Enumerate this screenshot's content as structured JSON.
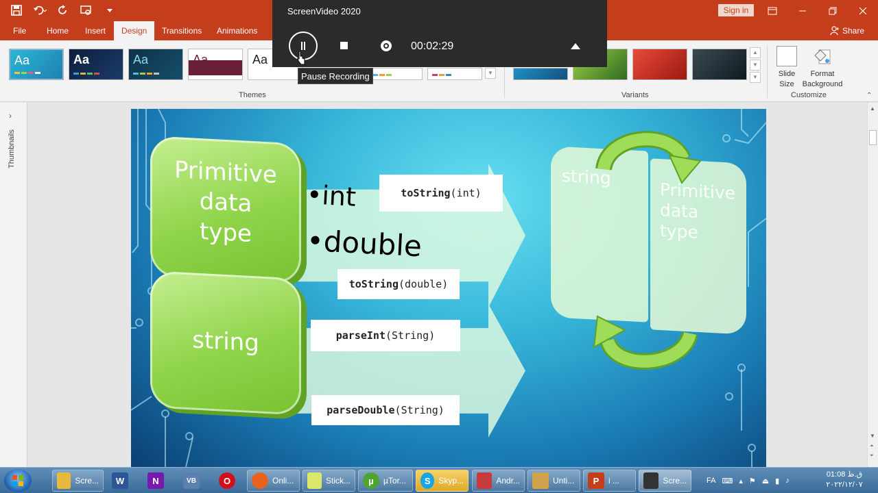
{
  "titlebar": {
    "sign_in": "Sign in",
    "accent": "#c43e1c"
  },
  "tabs": [
    {
      "label": "File"
    },
    {
      "label": "Home"
    },
    {
      "label": "Insert"
    },
    {
      "label": "Design",
      "active": true
    },
    {
      "label": "Transitions"
    },
    {
      "label": "Animations"
    }
  ],
  "share_label": "Share",
  "ribbon": {
    "themes_label": "Themes",
    "variants_label": "Variants",
    "customize_label": "Customize",
    "slide_size_label": "Slide Size",
    "format_background_label_1": "Format",
    "format_background_label_2": "Background",
    "theme_glyph": "Aa"
  },
  "recorder": {
    "title": "ScreenVideo 2020",
    "timer": "00:02:29",
    "tooltip": "Pause Recording"
  },
  "thumbnails_label": "Thumbnails",
  "slide": {
    "box1": [
      "Primitive",
      "data",
      "type"
    ],
    "box2": "string",
    "bullet1": "•int",
    "bullet2": "•double",
    "tostring_int": {
      "method": "toString",
      "arg": "(int)"
    },
    "tostring_double": {
      "method": "toString",
      "arg": "(double)"
    },
    "parseint": {
      "method": "parseInt",
      "arg": "(String)"
    },
    "parsedouble": {
      "method": "parseDouble",
      "arg": "(String)"
    },
    "panel_left": "string",
    "panel_right": [
      "Primitive",
      "data",
      "type"
    ]
  },
  "taskbar": {
    "items": [
      {
        "label": "Scre...",
        "icon": "folder-icon",
        "color": "#e8b93a"
      },
      {
        "label": "",
        "icon": "word-icon",
        "text": "W",
        "color": "#2b5797"
      },
      {
        "label": "",
        "icon": "onenote-icon",
        "text": "N",
        "color": "#7719aa"
      },
      {
        "label": "",
        "icon": "vb-icon",
        "text": "VB",
        "color": "#5c7fb0"
      },
      {
        "label": "",
        "icon": "opera-icon",
        "text": "O",
        "color": "#d1101a"
      },
      {
        "label": "Onli...",
        "icon": "firefox-icon",
        "color": "#e8631e"
      },
      {
        "label": "Stick...",
        "icon": "sticky-notes-icon",
        "color": "#d9e86b"
      },
      {
        "label": "µTor...",
        "icon": "utorrent-icon",
        "text": "µ",
        "color": "#4ea331"
      },
      {
        "label": "Skyp...",
        "icon": "skype-icon",
        "text": "S",
        "color": "#19a5e3"
      },
      {
        "label": "Andr...",
        "icon": "pdf-icon",
        "color": "#c93a3a"
      },
      {
        "label": "Unti...",
        "icon": "paint-icon",
        "color": "#cfa24b"
      },
      {
        "label": "i ...",
        "icon": "powerpoint-icon",
        "text": "P",
        "color": "#c43e1c"
      },
      {
        "label": "Scre...",
        "icon": "screenvideo-icon",
        "color": "#333333"
      }
    ],
    "lang": "FA",
    "time": "01:08 ق.ظ",
    "date": "۲۰۲۲/۱۲/۰۷"
  }
}
